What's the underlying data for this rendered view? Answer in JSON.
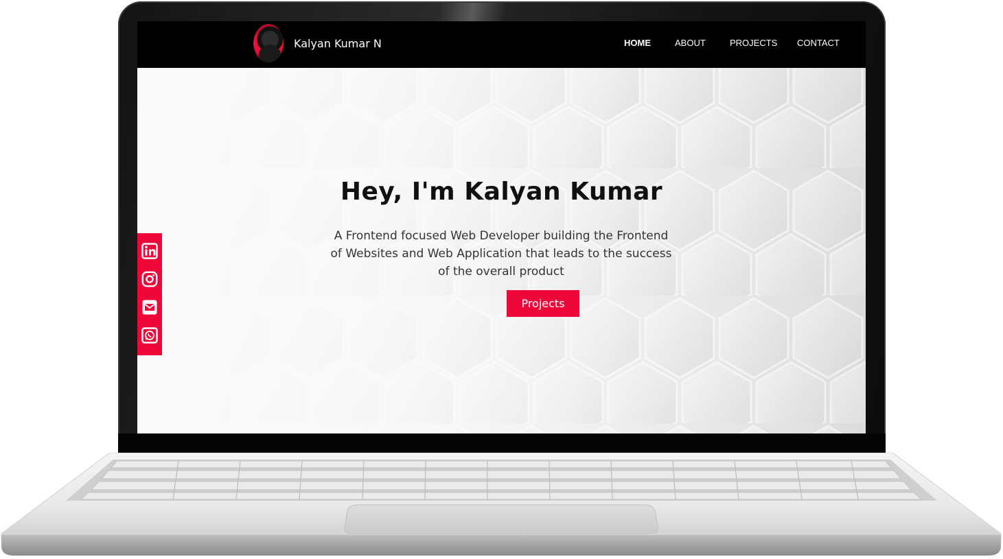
{
  "brand": {
    "name": "Kalyan Kumar N"
  },
  "nav": {
    "items": [
      {
        "label": "HOME",
        "active": true
      },
      {
        "label": "ABOUT",
        "active": false
      },
      {
        "label": "PROJECTS",
        "active": false
      },
      {
        "label": "CONTACT",
        "active": false
      }
    ]
  },
  "hero": {
    "title": "Hey, I'm Kalyan Kumar",
    "description": "A Frontend focused Web Developer building the Frontend of Websites and Web Application that leads to the success of the overall product",
    "button_label": "Projects"
  },
  "social": {
    "icons": [
      "linkedin-icon",
      "instagram-icon",
      "email-icon",
      "whatsapp-icon"
    ]
  },
  "colors": {
    "accent": "#f0073a",
    "navbar": "#000000",
    "text_dark": "#111111"
  }
}
